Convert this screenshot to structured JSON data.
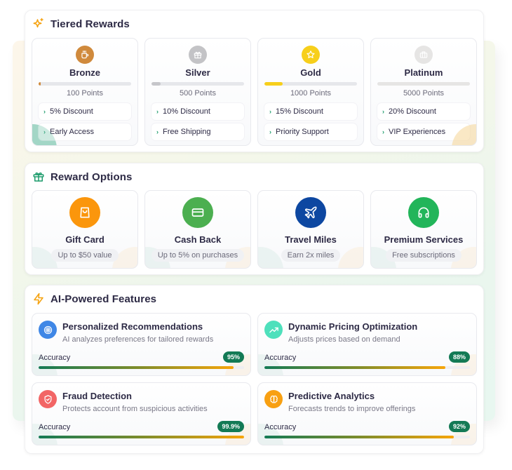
{
  "tiered_rewards": {
    "title": "Tiered Rewards",
    "icon": "sparkles-icon",
    "tiers": [
      {
        "name": "Bronze",
        "points": "100 Points",
        "progress_percent": 2,
        "icon": "coffee-icon",
        "color": "#d08a3c",
        "bar_color": "#d08a3c",
        "perks": [
          "5% Discount",
          "Early Access"
        ]
      },
      {
        "name": "Silver",
        "points": "500 Points",
        "progress_percent": 10,
        "icon": "gift-icon",
        "color": "#c3c3c6",
        "bar_color": "#c6c6ca",
        "perks": [
          "10% Discount",
          "Free Shipping"
        ]
      },
      {
        "name": "Gold",
        "points": "1000 Points",
        "progress_percent": 20,
        "icon": "star-icon",
        "color": "#f7cf1b",
        "bar_color": "#f7cf1b",
        "perks": [
          "15% Discount",
          "Priority Support"
        ]
      },
      {
        "name": "Platinum",
        "points": "5000 Points",
        "progress_percent": 100,
        "icon": "briefcase-icon",
        "color": "#e6e5e4",
        "bar_color": "#e6e5e4",
        "perks": [
          "20% Discount",
          "VIP Experiences"
        ]
      }
    ]
  },
  "reward_options": {
    "title": "Reward Options",
    "icon": "gift-icon",
    "options": [
      {
        "title": "Gift Card",
        "detail": "Up to $50 value",
        "icon": "shopping-bag-icon",
        "color": "#fb960c"
      },
      {
        "title": "Cash Back",
        "detail": "Up to 5% on purchases",
        "icon": "credit-card-icon",
        "color": "#4caf50"
      },
      {
        "title": "Travel Miles",
        "detail": "Earn 2x miles",
        "icon": "plane-icon",
        "color": "#0d47a1"
      },
      {
        "title": "Premium Services",
        "detail": "Free subscriptions",
        "icon": "headphones-icon",
        "color": "#22b55a"
      }
    ]
  },
  "ai_features": {
    "title": "AI-Powered Features",
    "icon": "lightning-icon",
    "accuracy_label": "Accuracy",
    "features": [
      {
        "title": "Personalized Recommendations",
        "description": "AI analyzes preferences for tailored rewards",
        "accuracy": "95%",
        "accuracy_value": 95,
        "icon": "target-icon",
        "color": "#3f87e6"
      },
      {
        "title": "Dynamic Pricing Optimization",
        "description": "Adjusts prices based on demand",
        "accuracy": "88%",
        "accuracy_value": 88,
        "icon": "trending-up-icon",
        "color": "#4ee0bc"
      },
      {
        "title": "Fraud Detection",
        "description": "Protects account from suspicious activities",
        "accuracy": "99.9%",
        "accuracy_value": 99.9,
        "icon": "shield-check-icon",
        "color": "#f26565"
      },
      {
        "title": "Predictive Analytics",
        "description": "Forecasts trends to improve offerings",
        "accuracy": "92%",
        "accuracy_value": 92,
        "icon": "brain-icon",
        "color": "#f8a012"
      }
    ]
  }
}
